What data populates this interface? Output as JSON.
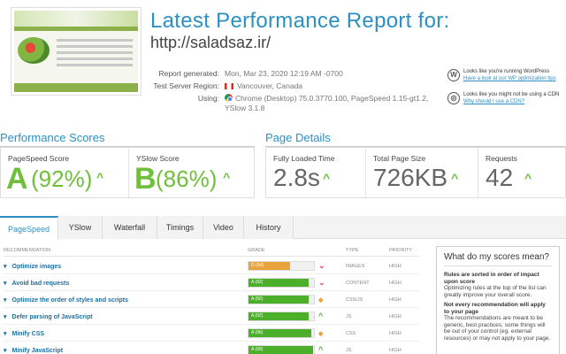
{
  "header": {
    "title": "Latest Performance Report for:",
    "url": "http://saladsaz.ir/"
  },
  "meta": {
    "generated_label": "Report generated:",
    "generated_value": "Mon, Mar 23, 2020 12:19 AM -0700",
    "region_label": "Test Server Region:",
    "region_value": "Vancouver, Canada",
    "using_label": "Using:",
    "using_value_line1": "Chrome (Desktop) 75.0.3770.100, PageSpeed 1.15-gt1.2,",
    "using_value_line2": "YSlow 3.1.8"
  },
  "side_notes": [
    {
      "icon": "wordpress-icon",
      "text": "Looks like you're running WordPress",
      "link": "Have a look at our WP optimization tips"
    },
    {
      "icon": "cdn-icon",
      "text": "Looks like you might not be using a CDN",
      "link": "Why should I use a CDN?"
    }
  ],
  "performance": {
    "heading": "Performance Scores",
    "pagespeed": {
      "label": "PageSpeed Score",
      "grade": "A",
      "pct": "(92%)"
    },
    "yslow": {
      "label": "YSlow Score",
      "grade": "B",
      "pct": "(86%)"
    }
  },
  "details": {
    "heading": "Page Details",
    "load": {
      "label": "Fully Loaded Time",
      "value": "2.8s"
    },
    "size": {
      "label": "Total Page Size",
      "value": "726KB"
    },
    "requests": {
      "label": "Requests",
      "value": "42"
    }
  },
  "tabs": [
    "PageSpeed",
    "YSlow",
    "Waterfall",
    "Timings",
    "Video",
    "History"
  ],
  "table": {
    "headers": {
      "recommendation": "Recommendation",
      "grade": "Grade",
      "type": "Type",
      "priority": "Priority"
    },
    "rows": [
      {
        "name": "Optimize images",
        "grade": "D (64)",
        "score": 0.64,
        "color": "#e8a33d",
        "trend": "down",
        "type": "IMAGES",
        "priority": "HIGH"
      },
      {
        "name": "Avoid bad requests",
        "grade": "A (92)",
        "score": 0.92,
        "color": "#4caf2a",
        "trend": "down",
        "type": "CONTENT",
        "priority": "HIGH"
      },
      {
        "name": "Optimize the order of styles and scripts",
        "grade": "A (92)",
        "score": 0.92,
        "color": "#4caf2a",
        "trend": "diamond",
        "type": "CSS/JS",
        "priority": "HIGH"
      },
      {
        "name": "Defer parsing of JavaScript",
        "grade": "A (92)",
        "score": 0.92,
        "color": "#4caf2a",
        "trend": "up",
        "type": "JS",
        "priority": "HIGH"
      },
      {
        "name": "Minify CSS",
        "grade": "A (96)",
        "score": 0.96,
        "color": "#4caf2a",
        "trend": "diamond",
        "type": "CSS",
        "priority": "HIGH"
      },
      {
        "name": "Minify JavaScript",
        "grade": "A (99)",
        "score": 0.99,
        "color": "#4caf2a",
        "trend": "up",
        "type": "JS",
        "priority": "HIGH"
      }
    ]
  },
  "panel": {
    "heading": "What do my scores mean?",
    "t1": "Rules are sorted in order of impact upon score",
    "p1": "Optimizing rules at the top of the list can greatly improve your overall score.",
    "t2": "Not every recommendation will apply to your page",
    "p2": "The recommendations are meant to be generic, best practices; some things will be out of your control (eg. external resources) or may not apply to your page."
  }
}
